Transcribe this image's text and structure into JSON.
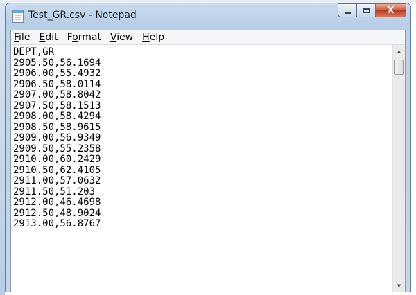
{
  "window": {
    "title": "Test_GR.csv - Notepad",
    "close_glyph": "X"
  },
  "menu": [
    "File",
    "Edit",
    "Format",
    "View",
    "Help"
  ],
  "menu_mnemonics": [
    "F",
    "E",
    "o",
    "V",
    "H"
  ],
  "content": {
    "lines": [
      "DEPT,GR",
      "2905.50,56.1694",
      "2906.00,55.4932",
      "2906.50,58.0114",
      "2907.00,58.8042",
      "2907.50,58.1513",
      "2908.00,58.4294",
      "2908.50,58.9615",
      "2909.00,56.9349",
      "2909.50,55.2358",
      "2910.00,60.2429",
      "2910.50,62.4105",
      "2911.00,57.0632",
      "2911.50,51.203",
      "2912.00,46.4698",
      "2912.50,48.9024",
      "2913.00,56.8767"
    ]
  },
  "icons": {
    "app": "notepad-icon",
    "minimize": "minimize-icon",
    "maximize": "maximize-icon",
    "close": "close-icon",
    "scroll_up": "chevron-up-icon",
    "scroll_down": "chevron-down-icon"
  },
  "colors": {
    "close_button": "#c85a43",
    "frame": "#bdd2e8"
  }
}
